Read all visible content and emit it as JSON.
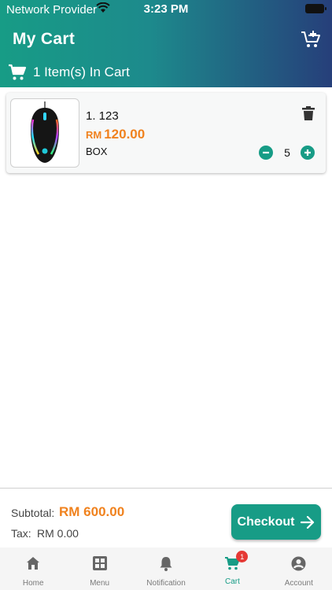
{
  "status_bar": {
    "carrier": "Network Provider",
    "time": "3:23 PM"
  },
  "header": {
    "title": "My Cart",
    "cart_icon": "add-to-cart-icon",
    "items_in_cart_text": "1 Item(s) In Cart"
  },
  "cart_items": [
    {
      "name": "1. 123",
      "currency": "RM",
      "price": "120.00",
      "uom": "BOX",
      "quantity": "5"
    }
  ],
  "summary": {
    "subtotal_label": "Subtotal:",
    "subtotal_value": "RM 600.00",
    "tax_label": "Tax:",
    "tax_value": "RM 0.00",
    "checkout_label": "Checkout"
  },
  "bottom_nav": {
    "items": [
      {
        "label": "Home",
        "icon": "home-icon"
      },
      {
        "label": "Menu",
        "icon": "grid-icon"
      },
      {
        "label": "Notification",
        "icon": "bell-icon"
      },
      {
        "label": "Cart",
        "icon": "cart-icon",
        "badge": "1",
        "active": true
      },
      {
        "label": "Account",
        "icon": "account-icon"
      }
    ]
  },
  "colors": {
    "accent": "#179c86",
    "price": "#f0821e",
    "badge": "#e53935",
    "header_end": "#263f7a"
  }
}
